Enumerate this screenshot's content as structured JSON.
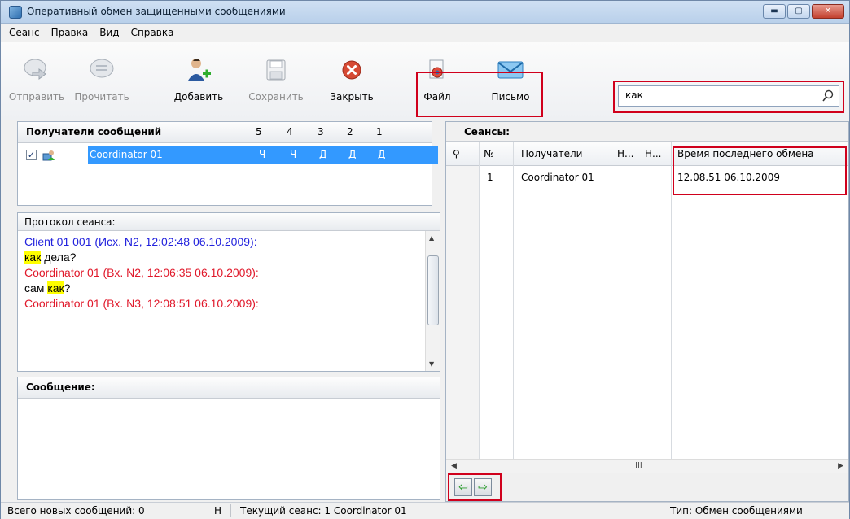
{
  "window": {
    "title": "Оперативный обмен защищенными сообщениями",
    "controls": {
      "minimize": "▬",
      "maximize": "▢",
      "close": "✕"
    }
  },
  "menu": [
    {
      "label": "Сеанс"
    },
    {
      "label": "Правка"
    },
    {
      "label": "Вид"
    },
    {
      "label": "Справка"
    }
  ],
  "toolbar": {
    "send": "Отправить",
    "read": "Прочитать",
    "add": "Добавить",
    "save": "Сохранить",
    "close": "Закрыть",
    "file": "Файл",
    "letter": "Письмо"
  },
  "search": {
    "value": "как"
  },
  "recipients": {
    "title": "Получатели сообщений",
    "columns": [
      "5",
      "4",
      "3",
      "2",
      "1"
    ],
    "rows": [
      {
        "name": "Coordinator 01",
        "checked": true,
        "cells": [
          "Ч",
          "Ч",
          "Д",
          "Д",
          "Д"
        ]
      }
    ]
  },
  "protocol": {
    "title": "Протокол сеанса:",
    "line1": "Client 01 001 (Исх. N2, 12:02:48 06.10.2009):",
    "line2_hl": "как",
    "line2_rest": " дела?",
    "line3": "Coordinator 01 (Вх. N2, 12:06:35 06.10.2009):",
    "line4_pre": "сам ",
    "line4_hl": "как",
    "line4_post": "?",
    "line5": "Coordinator 01 (Вх. N3, 12:08:51 06.10.2009):"
  },
  "message": {
    "title": "Сообщение:"
  },
  "sessions": {
    "title": "Сеансы:",
    "columns": {
      "flag": "⚲",
      "num": "№",
      "recipients": "Получатели",
      "n1": "Н...",
      "n2": "Н...",
      "last_exchange": "Время последнего обмена"
    },
    "rows": [
      {
        "num": "1",
        "recipient": "Coordinator 01",
        "last_exchange": "12.08.51 06.10.2009"
      }
    ],
    "scroll_mark": "III"
  },
  "status": {
    "new_messages": "Всего новых сообщений: 0",
    "cut": "Н",
    "current_session": "Текущий сеанс: 1  Coordinator 01",
    "type": "Тип: Обмен сообщениями"
  },
  "colors": {
    "selection": "#3399ff",
    "outgoing_text": "#2222dd",
    "incoming_text": "#e0182a",
    "highlight": "#ffff00",
    "annotation_box": "#d0001c"
  }
}
